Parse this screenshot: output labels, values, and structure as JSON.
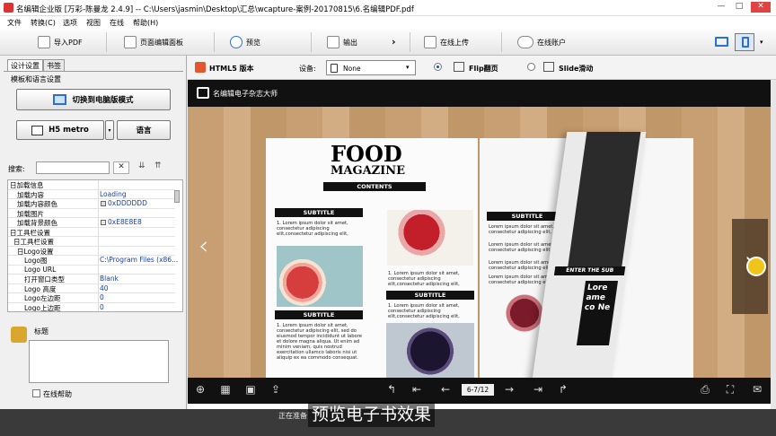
{
  "window": {
    "title": "名编辑企业版 [万彩-陈曼龙 2.4.9] -- C:\\Users\\jasmin\\Desktop\\汇总\\wcapture-案例-20170815\\6.名编辑PDF.pdf",
    "min": "—",
    "max": "□",
    "close": "✕"
  },
  "menu": [
    "文件",
    "转换(C)",
    "选项",
    "视图",
    "在线",
    "帮助(H)"
  ],
  "toolbar": {
    "import_pdf": "导入PDF",
    "page_editor": "页面编辑面板",
    "preview": "预览",
    "output": "输出",
    "upload": "在线上传",
    "online_account": "在线账户"
  },
  "left": {
    "tabs": [
      "设计设置",
      "书签"
    ],
    "section_title": "模板和语言设置",
    "switch_mode_button": "切换到电脑版模式",
    "template_name": "H5 metro",
    "language_button": "语言",
    "search_label": "搜索:",
    "search_value": "",
    "properties": [
      {
        "key": "日加载信息",
        "value": "",
        "indent": 0
      },
      {
        "key": "加载内容",
        "value": "Loading",
        "indent": 2
      },
      {
        "key": "加载内容颜色",
        "value": "0xDDDDDD",
        "indent": 2,
        "swatch": "#dddddd"
      },
      {
        "key": "加载图片",
        "value": "",
        "indent": 2
      },
      {
        "key": "加载背景颜色",
        "value": "0xE8E8E8",
        "indent": 2,
        "swatch": "#e8e8e8"
      },
      {
        "key": "日工具栏设置",
        "value": "",
        "indent": 0
      },
      {
        "key": "日工具栏设置",
        "value": "",
        "indent": 1
      },
      {
        "key": "日Logo设置",
        "value": "",
        "indent": 2
      },
      {
        "key": "Logo图",
        "value": "C:\\Program Files (x86...",
        "indent": 4
      },
      {
        "key": "Logo URL",
        "value": "",
        "indent": 4
      },
      {
        "key": "打开窗口类型",
        "value": "Blank",
        "indent": 4
      },
      {
        "key": "Logo 高度",
        "value": "40",
        "indent": 4
      },
      {
        "key": "Logo左边距",
        "value": "0",
        "indent": 4
      },
      {
        "key": "Logo上边距",
        "value": "0",
        "indent": 4
      }
    ],
    "title_label": "标题",
    "online_help": "在线帮助"
  },
  "main": {
    "html5_label": "HTML5 版本",
    "device_label": "设备:",
    "device_value": "None",
    "flip_label": "Flip翻页",
    "slide_label": "Slide滑动",
    "book_header": "名编辑电子杂志大师",
    "page_indicator": "6-7/12",
    "magazine": {
      "food": "FOOD",
      "magazine": "MAGAZINE",
      "contents": "CONTENTS",
      "subtitle": "SUBTITLE",
      "lorem": "1. Lorem ipsum dolor sit amet, consectetur adipiscing elit,consectetur adipiscing elit,",
      "lorem_long": "1. Lorem ipsum dolor sit amet, consectetur adipiscing elit, sed do eiusmod tempor incididunt ut labore et dolore magna aliqua. Ut enim ad minim veniam, quis nostrud exercitation ullamco laboris nisi ut aliquip ex ea commodo consequat.",
      "lorem_short": "Lorem ipsum dolor sit amet, consectetur adipiscing elit,",
      "enter_the_sub": "ENTER THE SUB",
      "side_text": "Lore ame co Ne"
    }
  },
  "status_text": "正在准备",
  "caption": "预览电子书效果",
  "colors": {
    "accent": "#2a6fd6",
    "dark": "#111111",
    "wood": "#c9a57a"
  }
}
